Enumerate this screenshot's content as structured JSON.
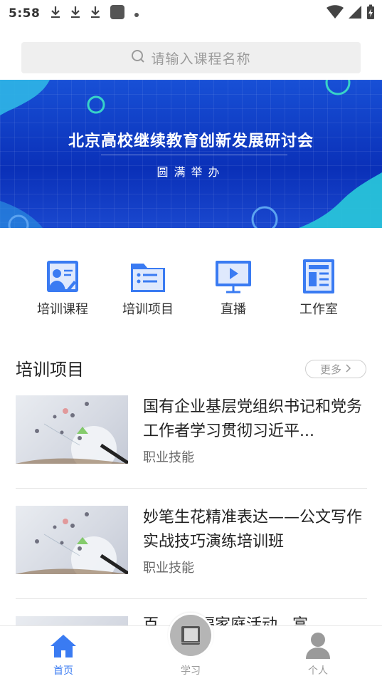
{
  "status_bar": {
    "time": "5:58"
  },
  "search": {
    "placeholder": "请输入课程名称"
  },
  "banner": {
    "title": "北京高校继续教育创新发展研讨会",
    "subtitle": "圆满举办"
  },
  "categories": [
    {
      "label": "培训课程",
      "icon": "course-icon"
    },
    {
      "label": "培训项目",
      "icon": "folder-list-icon"
    },
    {
      "label": "直播",
      "icon": "live-play-icon"
    },
    {
      "label": "工作室",
      "icon": "studio-icon"
    }
  ],
  "section": {
    "title": "培训项目",
    "more_label": "更多"
  },
  "items": [
    {
      "title": "国有企业基层党组织书记和党务工作者学习贯彻习近平...",
      "tag": "职业技能"
    },
    {
      "title": "妙笔生花精准表达——公文写作实战技巧演练培训班",
      "tag": "职业技能"
    },
    {
      "title": "百  ...  责福家庭活动...富",
      "tag": ""
    }
  ],
  "bottom_nav": [
    {
      "label": "首页",
      "icon": "home-icon",
      "active": true
    },
    {
      "label": "学习",
      "icon": "book-icon",
      "active": false
    },
    {
      "label": "个人",
      "icon": "person-icon",
      "active": false
    }
  ],
  "colors": {
    "accent": "#3a7bf2",
    "inactive": "#9a9a9a",
    "banner": "#0a30b8"
  }
}
